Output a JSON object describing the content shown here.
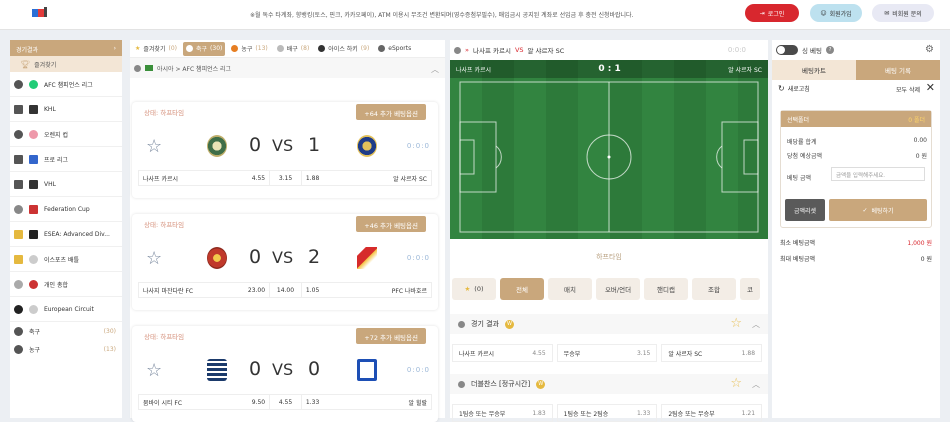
{
  "header": {
    "notice": "※월 독수 타계좌, 향뱅킹(토스, 핀크, 카카오페이), ATM 이용시 무조건 변환되며(영수증첨부필수), 매입금시 공지된 계좌로 선입금 후 충전 신청바랍니다.",
    "login": "로그인",
    "join": "회원가입",
    "guest": "비회원 문의"
  },
  "sidebar": {
    "title": "경기결과",
    "favorites": "즐겨찾기",
    "items": [
      {
        "label": "AFC 챔피언스 리그",
        "icon": "soccer-icon"
      },
      {
        "label": "KHL",
        "icon": "hockey-icon"
      },
      {
        "label": "오렌지 컵",
        "icon": "soccer-icon"
      },
      {
        "label": "프로 리그",
        "icon": "hockey-icon"
      },
      {
        "label": "VHL",
        "icon": "hockey-icon"
      },
      {
        "label": "Federation Cup",
        "icon": "tennis-icon"
      },
      {
        "label": "ESEA: Advanced Div...",
        "icon": "esports-icon"
      },
      {
        "label": "이스포츠 배틀",
        "icon": "esports-icon"
      },
      {
        "label": "개인 총합",
        "icon": "volleyball-icon"
      },
      {
        "label": "European Circuit",
        "icon": "table-tennis-icon"
      }
    ],
    "sports": [
      {
        "label": "축구",
        "count": "(30)"
      },
      {
        "label": "농구",
        "count": "(13)"
      }
    ]
  },
  "tabs": [
    {
      "label": "즐겨찾기",
      "count": "(0)"
    },
    {
      "label": "축구",
      "count": "(30)"
    },
    {
      "label": "농구",
      "count": "(13)"
    },
    {
      "label": "배구",
      "count": "(8)"
    },
    {
      "label": "아이스 하키",
      "count": "(9)"
    },
    {
      "label": "eSports",
      "count": ""
    }
  ],
  "league": {
    "path": "아시아 > AFC 챔피언스 리그"
  },
  "matches": [
    {
      "status": "상태: 하프타임",
      "more": "+64 추가 베팅옵션",
      "home_score": "0",
      "vs": "VS",
      "away_score": "1",
      "tag": "0:0:0",
      "home": "나사프 카르시",
      "home_odd": "4.55",
      "draw_odd": "3.15",
      "away_odd": "1.88",
      "away": "알 샤르자 SC"
    },
    {
      "status": "상태: 하프타임",
      "more": "+46 추가 베팅옵션",
      "home_score": "0",
      "vs": "VS",
      "away_score": "2",
      "tag": "0:0:0",
      "home": "나사지 마잔다란 FC",
      "home_odd": "23.00",
      "draw_odd": "14.00",
      "away_odd": "1.05",
      "away": "PFC 나바호르"
    },
    {
      "status": "상태: 하프타임",
      "more": "+72 추가 베팅옵션",
      "home_score": "0",
      "vs": "VS",
      "away_score": "0",
      "tag": "0:0:0",
      "home": "뭄바이 시티 FC",
      "home_odd": "9.50",
      "draw_odd": "4.55",
      "away_odd": "1.33",
      "away": "알 힐랄"
    }
  ],
  "live": {
    "home": "나사프 카르시",
    "vs": "VS",
    "away": "알 샤르자 SC",
    "tag": "0:0:0",
    "score": "0 : 1",
    "period": "하프타임",
    "markets": [
      "(0)",
      "전체",
      "매치",
      "오버/언더",
      "핸디캡",
      "조합",
      "코"
    ],
    "section1": {
      "title": "경기 결과",
      "w": "W",
      "cells": [
        {
          "label": "나사프 카르시",
          "odd": "4.55"
        },
        {
          "label": "무승부",
          "odd": "3.15"
        },
        {
          "label": "알 샤르자 SC",
          "odd": "1.88"
        }
      ]
    },
    "section2": {
      "title": "더블찬스 [정규시간]",
      "w": "W",
      "cells": [
        {
          "label": "1팀승 또는 무승부",
          "odd": "1.83"
        },
        {
          "label": "1팀승 또는 2팀승",
          "odd": "1.33"
        },
        {
          "label": "2팀승 또는 무승부",
          "odd": "1.21"
        }
      ]
    }
  },
  "betslip": {
    "single": "싱 베팅",
    "tab_cart": "베팅카트",
    "tab_history": "베팅 기록",
    "refresh": "새로고침",
    "delete_all": "모두 삭제",
    "selected": "선택폴더",
    "selected_val": "0 폴더",
    "total_odds": "배당률 합계",
    "total_odds_val": "0.00",
    "expected": "당첨 예상금액",
    "expected_val": "0 원",
    "amount": "베팅 금액",
    "amount_placeholder": "금액을 입력해주세요.",
    "reset": "금액리셋",
    "bet": "베팅하기",
    "min": "최소 베팅금액",
    "min_val": "1,000 원",
    "max": "최대 베팅금액",
    "max_val": "0 원"
  }
}
